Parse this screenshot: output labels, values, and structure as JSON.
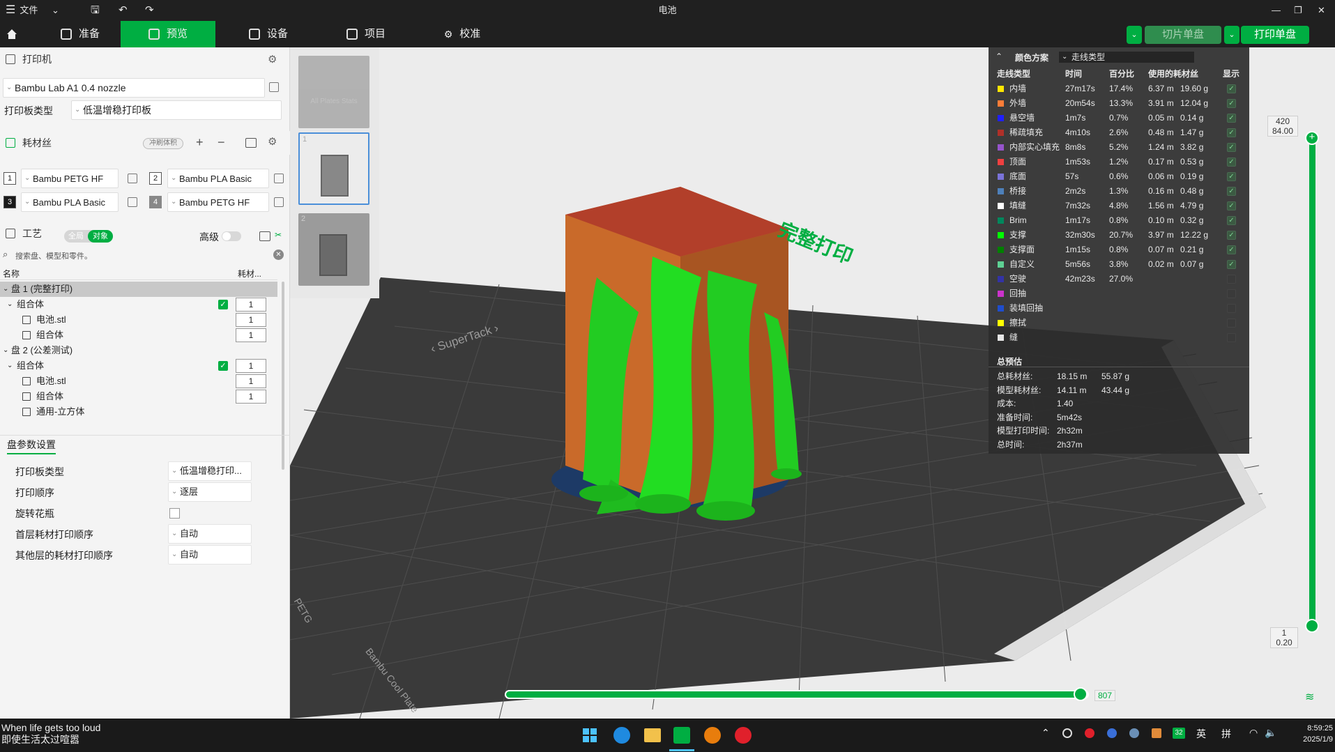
{
  "titlebar": {
    "menu_label": "文件",
    "window_title": "电池"
  },
  "tabs": {
    "prepare": "准备",
    "preview": "预览",
    "device": "设备",
    "project": "项目",
    "calibrate": "校准"
  },
  "actions": {
    "slice_plate": "切片单盘",
    "print_plate": "打印单盘"
  },
  "printer": {
    "section_title": "打印机",
    "name": "Bambu Lab A1 0.4 nozzle",
    "plate_type_label": "打印板类型",
    "plate_type_value": "低温增稳打印板"
  },
  "filament": {
    "section_title": "耗材丝",
    "flush_label": "冲刷体积",
    "slots": [
      {
        "num": "1",
        "name": "Bambu PETG HF"
      },
      {
        "num": "2",
        "name": "Bambu PLA Basic"
      },
      {
        "num": "3",
        "name": "Bambu PLA Basic"
      },
      {
        "num": "4",
        "name": "Bambu PETG HF"
      }
    ]
  },
  "process": {
    "section_title": "工艺",
    "toggle_global": "全局",
    "toggle_object": "对象",
    "advanced_label": "高级",
    "search_placeholder": "搜索盘、模型和零件。",
    "col_name": "名称",
    "col_filament": "耗材...",
    "tree": [
      {
        "label": "盘 1 (完整打印)",
        "qty": ""
      },
      {
        "label": "组合体",
        "qty": "1"
      },
      {
        "label": "电池.stl",
        "qty": "1"
      },
      {
        "label": "组合体",
        "qty": "1"
      },
      {
        "label": "盘 2 (公差测试)",
        "qty": ""
      },
      {
        "label": "组合体",
        "qty": "1"
      },
      {
        "label": "电池.stl",
        "qty": "1"
      },
      {
        "label": "组合体",
        "qty": "1"
      },
      {
        "label": "通用-立方体",
        "qty": ""
      }
    ]
  },
  "plate_settings": {
    "title": "盘参数设置",
    "rows": [
      {
        "label": "打印板类型",
        "value": "低温增稳打印..."
      },
      {
        "label": "打印顺序",
        "value": "逐层"
      },
      {
        "label": "旋转花瓶",
        "value": ""
      },
      {
        "label": "首层耗材打印顺序",
        "value": "自动"
      },
      {
        "label": "其他层的耗材打印顺序",
        "value": "自动"
      }
    ]
  },
  "thumbs": {
    "all_plates": "All Plates Stats",
    "plate1": "1",
    "plate2": "2"
  },
  "viewport": {
    "plate_label": "完整打印",
    "bed_text_1": "‹ SuperTack ›",
    "bed_text_2": "Bambu Cool Plate",
    "bed_text_3": "PETG",
    "bottom_slider_value": "807",
    "top_layer": "420",
    "top_height": "84.00",
    "bottom_layer": "1",
    "bottom_height": "0.20"
  },
  "legend": {
    "header": "颜色方案",
    "scheme": "走线类型",
    "col_type": "走线类型",
    "col_time": "时间",
    "col_pct": "百分比",
    "col_used": "使用的耗材丝",
    "col_show": "显示",
    "rows": [
      {
        "name": "内墙",
        "color": "#ffe600",
        "time": "27m17s",
        "pct": "17.4%",
        "len": "6.37 m",
        "wt": "19.60 g",
        "show": true
      },
      {
        "name": "外墙",
        "color": "#ff7d38",
        "time": "20m54s",
        "pct": "13.3%",
        "len": "3.91 m",
        "wt": "12.04 g",
        "show": true
      },
      {
        "name": "悬空墙",
        "color": "#1f1fff",
        "time": "1m7s",
        "pct": "0.7%",
        "len": "0.05 m",
        "wt": "0.14 g",
        "show": true
      },
      {
        "name": "稀疏填充",
        "color": "#b03029",
        "time": "4m10s",
        "pct": "2.6%",
        "len": "0.48 m",
        "wt": "1.47 g",
        "show": true
      },
      {
        "name": "内部实心填充",
        "color": "#9654cc",
        "time": "8m8s",
        "pct": "5.2%",
        "len": "1.24 m",
        "wt": "3.82 g",
        "show": true
      },
      {
        "name": "顶面",
        "color": "#f04040",
        "time": "1m53s",
        "pct": "1.2%",
        "len": "0.17 m",
        "wt": "0.53 g",
        "show": true
      },
      {
        "name": "底面",
        "color": "#7a73d9",
        "time": "57s",
        "pct": "0.6%",
        "len": "0.06 m",
        "wt": "0.19 g",
        "show": true
      },
      {
        "name": "桥接",
        "color": "#4d80ba",
        "time": "2m2s",
        "pct": "1.3%",
        "len": "0.16 m",
        "wt": "0.48 g",
        "show": true
      },
      {
        "name": "填缝",
        "color": "#ffffff",
        "time": "7m32s",
        "pct": "4.8%",
        "len": "1.56 m",
        "wt": "4.79 g",
        "show": true
      },
      {
        "name": "Brim",
        "color": "#00875c",
        "time": "1m17s",
        "pct": "0.8%",
        "len": "0.10 m",
        "wt": "0.32 g",
        "show": true
      },
      {
        "name": "支撑",
        "color": "#00ff00",
        "time": "32m30s",
        "pct": "20.7%",
        "len": "3.97 m",
        "wt": "12.22 g",
        "show": true
      },
      {
        "name": "支撑面",
        "color": "#008000",
        "time": "1m15s",
        "pct": "0.8%",
        "len": "0.07 m",
        "wt": "0.21 g",
        "show": true
      },
      {
        "name": "自定义",
        "color": "#5ed194",
        "time": "5m56s",
        "pct": "3.8%",
        "len": "0.02 m",
        "wt": "0.07 g",
        "show": true
      },
      {
        "name": "空驶",
        "color": "#3333a6",
        "time": "42m23s",
        "pct": "27.0%",
        "len": "",
        "wt": "",
        "show": false
      },
      {
        "name": "回抽",
        "color": "#cc33cc",
        "time": "",
        "pct": "",
        "len": "",
        "wt": "",
        "show": false
      },
      {
        "name": "装填回抽",
        "color": "#1f4dcc",
        "time": "",
        "pct": "",
        "len": "",
        "wt": "",
        "show": false
      },
      {
        "name": "擦拭",
        "color": "#ffff00",
        "time": "",
        "pct": "",
        "len": "",
        "wt": "",
        "show": false
      },
      {
        "name": "缝",
        "color": "#e6e6e6",
        "time": "",
        "pct": "",
        "len": "",
        "wt": "",
        "show": false
      }
    ],
    "summary_title": "总预估",
    "summary": [
      {
        "label": "总耗材丝:",
        "v1": "18.15 m",
        "v2": "55.87 g"
      },
      {
        "label": "模型耗材丝:",
        "v1": "14.11 m",
        "v2": "43.44 g"
      },
      {
        "label": "成本:",
        "v1": "1.40",
        "v2": ""
      },
      {
        "label": "准备时间:",
        "v1": "5m42s",
        "v2": ""
      },
      {
        "label": "模型打印时间:",
        "v1": "2h32m",
        "v2": ""
      },
      {
        "label": "总时间:",
        "v1": "2h37m",
        "v2": ""
      }
    ]
  },
  "taskbar": {
    "media_line1": "When life gets too loud",
    "media_line2": "即使生活太过喧嚣",
    "ime1": "英",
    "ime2": "拼",
    "badge": "32",
    "time": "8:59:25",
    "date": "2025/1/9"
  },
  "colors": {
    "accent": "#00ae42",
    "model_orange": "#c96a2a",
    "support_green": "#22cc22",
    "bed": "#3a3a3a"
  }
}
